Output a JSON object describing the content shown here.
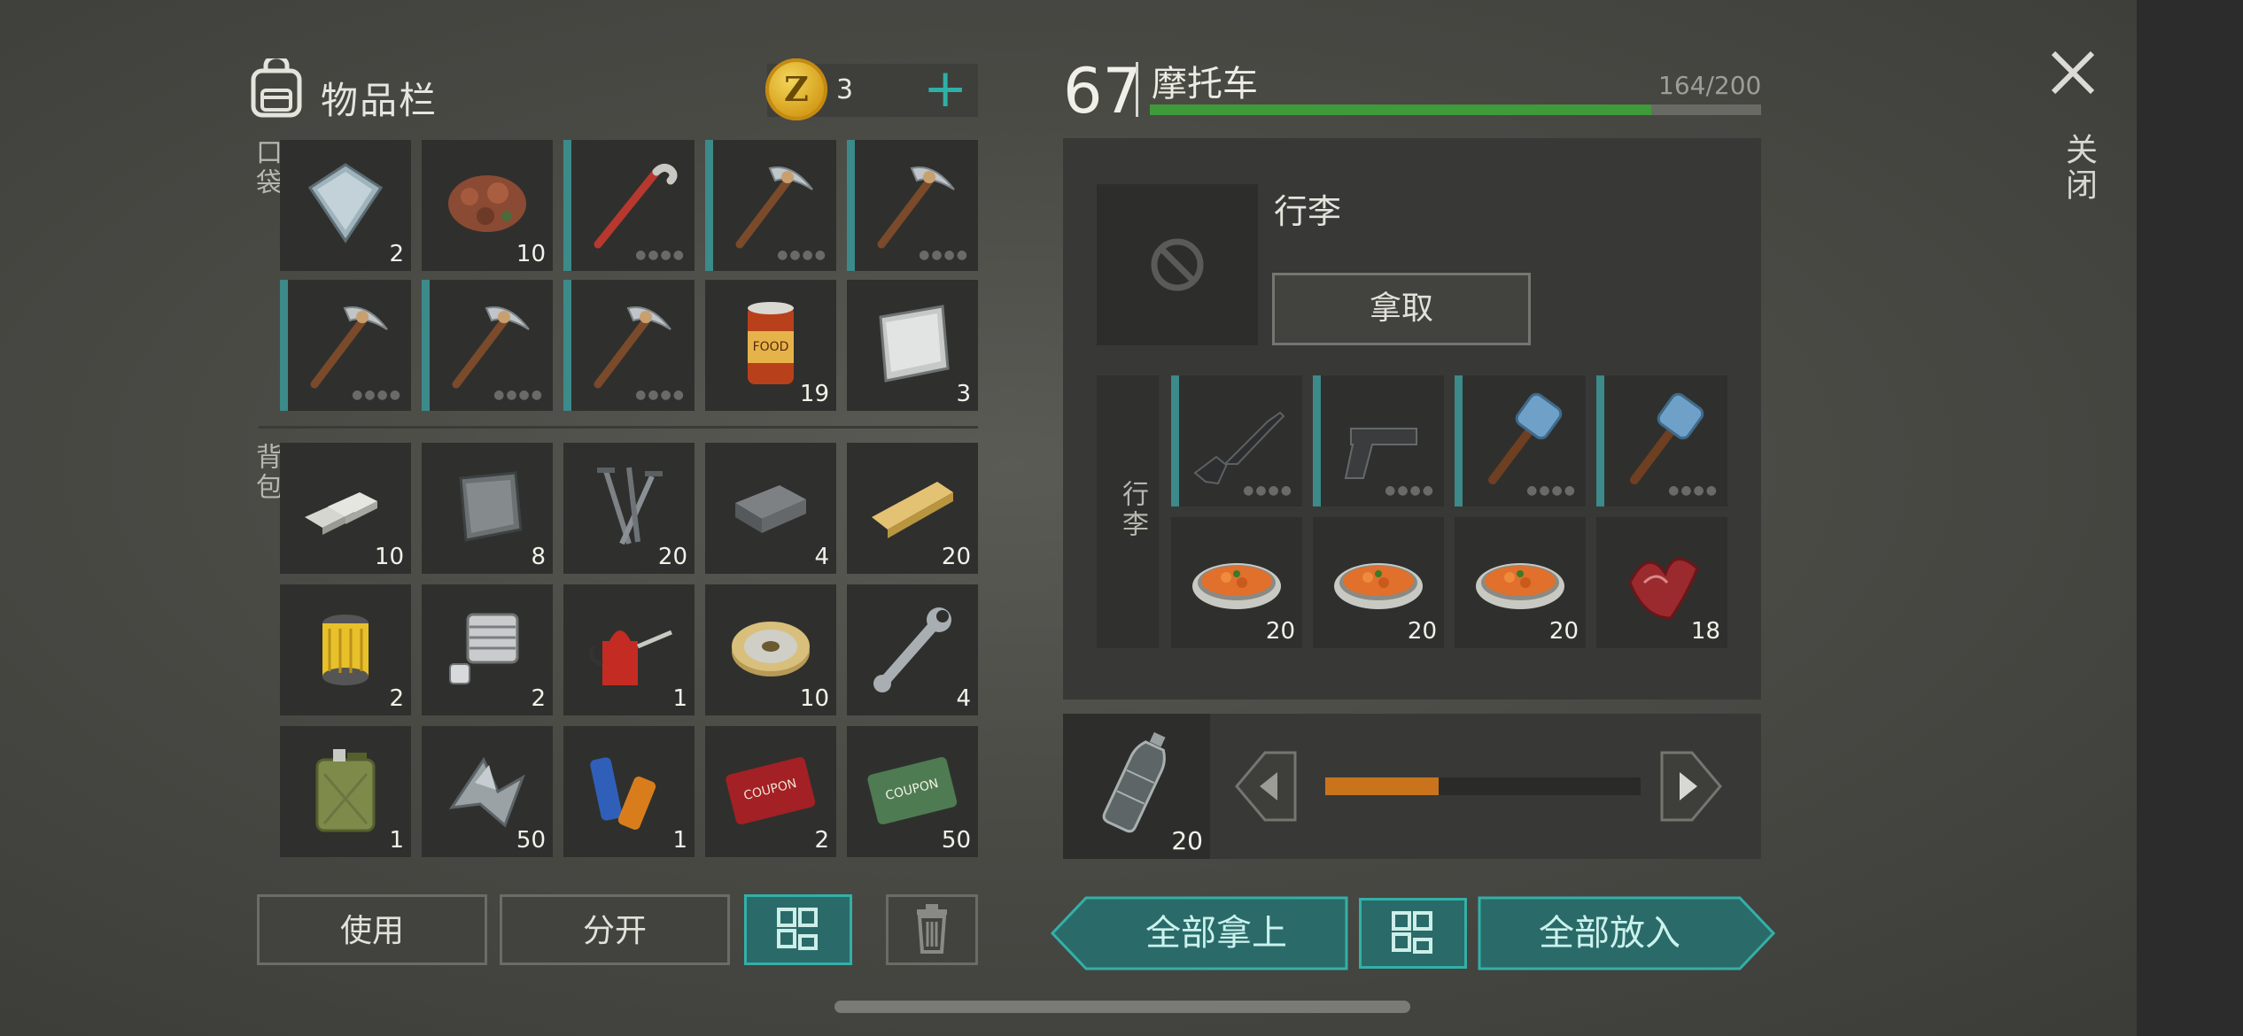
{
  "inventory": {
    "title": "物品栏",
    "coins": "3",
    "pockets_label": "口袋",
    "backpack_label": "背包",
    "pockets": [
      {
        "icon": "metal-plate-icon",
        "qty": "2",
        "dur": false
      },
      {
        "icon": "ore-icon",
        "qty": "10",
        "dur": false
      },
      {
        "icon": "crowbar-icon",
        "qty": "",
        "dur": true
      },
      {
        "icon": "pickaxe-icon",
        "qty": "",
        "dur": true
      },
      {
        "icon": "pickaxe-icon",
        "qty": "",
        "dur": true
      },
      {
        "icon": "pickaxe-icon",
        "qty": "",
        "dur": true
      },
      {
        "icon": "pickaxe-icon",
        "qty": "",
        "dur": true
      },
      {
        "icon": "pickaxe-icon",
        "qty": "",
        "dur": true
      },
      {
        "icon": "food-can-icon",
        "qty": "19",
        "dur": false
      },
      {
        "icon": "steel-plate-icon",
        "qty": "3",
        "dur": false
      }
    ],
    "backpack": [
      {
        "icon": "iron-bars-icon",
        "qty": "10"
      },
      {
        "icon": "sheet-metal-icon",
        "qty": "8"
      },
      {
        "icon": "nails-icon",
        "qty": "20"
      },
      {
        "icon": "iron-ingot-icon",
        "qty": "4"
      },
      {
        "icon": "wood-plank-icon",
        "qty": "20"
      },
      {
        "icon": "air-filter-icon",
        "qty": "2"
      },
      {
        "icon": "engine-cylinder-icon",
        "qty": "2"
      },
      {
        "icon": "oil-can-icon",
        "qty": "1"
      },
      {
        "icon": "wire-spool-icon",
        "qty": "10"
      },
      {
        "icon": "wrench-icon",
        "qty": "4"
      },
      {
        "icon": "jerrycan-icon",
        "qty": "1"
      },
      {
        "icon": "scrap-metal-icon",
        "qty": "50"
      },
      {
        "icon": "batteries-icon",
        "qty": "1"
      },
      {
        "icon": "combat-coupon-icon",
        "qty": "2"
      },
      {
        "icon": "ration-coupon-icon",
        "qty": "50"
      }
    ],
    "buttons": {
      "use": "使用",
      "split": "分开"
    }
  },
  "vehicle": {
    "level": "67",
    "name": "摩托车",
    "capacity": "164/200",
    "capacity_fraction": 0.82,
    "luggage_title": "行李",
    "take_label": "拿取",
    "cargo_label": "行李",
    "cargo": [
      {
        "icon": "assault-rifle-icon",
        "qty": "",
        "dur": true
      },
      {
        "icon": "pistol-icon",
        "qty": "",
        "dur": true
      },
      {
        "icon": "hammer-icon",
        "qty": "",
        "dur": true
      },
      {
        "icon": "hammer-icon",
        "qty": "",
        "dur": true
      },
      {
        "icon": "stew-bowl-icon",
        "qty": "20",
        "dur": false
      },
      {
        "icon": "stew-bowl-icon",
        "qty": "20",
        "dur": false
      },
      {
        "icon": "stew-bowl-icon",
        "qty": "20",
        "dur": false
      },
      {
        "icon": "raw-meat-icon",
        "qty": "18",
        "dur": false
      }
    ],
    "fuel_qty": "20",
    "fuel_fraction": 0.36,
    "take_all": "全部拿上",
    "put_all": "全部放入"
  },
  "close_label": "关闭",
  "colors": {
    "teal": "#33b0a8",
    "durability": "#3c8a8a",
    "capacity": "#3f9a3a",
    "fuel": "#c9741c"
  }
}
